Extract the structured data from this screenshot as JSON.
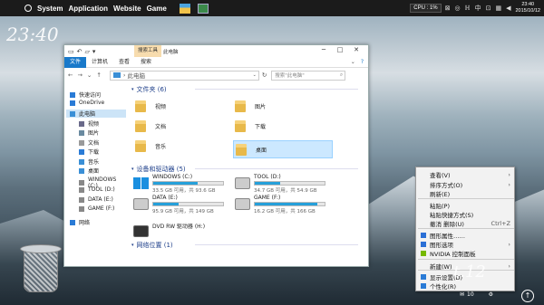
{
  "topbar": {
    "menus": [
      "System",
      "Application",
      "Website",
      "Game"
    ],
    "cpu_label": "CPU : 1%",
    "time": "23:40",
    "date": "2015/10/12",
    "symbols": [
      "⊠",
      "◎",
      "ℍ",
      "中",
      "⊡",
      "▦",
      "◀"
    ]
  },
  "desktop": {
    "big_clock": "23:40",
    "right_clock": "t.12"
  },
  "explorer": {
    "ribbon_context_tab": "搜索工具",
    "title": "此电脑",
    "tabs": [
      "文件",
      "计算机",
      "查看",
      "搜索"
    ],
    "address": "此电脑",
    "search_placeholder": "搜索\"此电脑\"",
    "nav": [
      {
        "label": "快速访问",
        "color": "#2a7bd6"
      },
      {
        "label": "OneDrive",
        "color": "#2a7bd6"
      },
      {
        "label": "此电脑",
        "color": "#3a8fd6"
      },
      {
        "label": "视频",
        "color": "#6a6a8a"
      },
      {
        "label": "图片",
        "color": "#6a8aa0"
      },
      {
        "label": "文档",
        "color": "#9a9a9a"
      },
      {
        "label": "下载",
        "color": "#2a7bd6"
      },
      {
        "label": "音乐",
        "color": "#3a8fd6"
      },
      {
        "label": "桌面",
        "color": "#3a8fd6"
      },
      {
        "label": "WINDOWS (C:)",
        "color": "#888"
      },
      {
        "label": "TOOL (D:)",
        "color": "#888"
      },
      {
        "label": "DATA (E:)",
        "color": "#888"
      },
      {
        "label": "GAME (F:)",
        "color": "#888"
      },
      {
        "label": "网络",
        "color": "#2a7bd6"
      }
    ],
    "folders_header": "文件夹 (6)",
    "folders": [
      "视频",
      "图片",
      "文档",
      "下载",
      "音乐",
      "桌面"
    ],
    "devices_header": "设备和驱动器 (5)",
    "drives": [
      {
        "name": "WINDOWS (C:)",
        "free": "33.5 GB 可用，共 93.6 GB",
        "used_fraction": 0.64,
        "type": "win"
      },
      {
        "name": "TOOL (D:)",
        "free": "34.7 GB 可用，共 54.9 GB",
        "used_fraction": 0.37,
        "type": "hdd"
      },
      {
        "name": "DATA (E:)",
        "free": "95.9 GB 可用，共 149 GB",
        "used_fraction": 0.36,
        "type": "hdd"
      },
      {
        "name": "GAME (F:)",
        "free": "16.2 GB 可用，共 166 GB",
        "used_fraction": 0.9,
        "type": "hdd"
      },
      {
        "name": "DVD RW 驱动器 (H:)",
        "type": "dvd"
      }
    ],
    "network_header": "网络位置 (1)"
  },
  "context_menu": {
    "items": [
      {
        "label": "查看(V)",
        "accel": "›"
      },
      {
        "label": "排序方式(O)",
        "accel": "›"
      },
      {
        "label": "刷新(E)",
        "accel": ""
      },
      {
        "label": "粘贴(P)",
        "accel": ""
      },
      {
        "label": "粘贴快捷方式(S)",
        "accel": ""
      },
      {
        "label": "撤消 删除(U)",
        "accel": "Ctrl+Z"
      },
      {
        "label": "图形属性……",
        "accel": ""
      },
      {
        "label": "图形选项",
        "accel": "›"
      },
      {
        "label": "NVIDIA 控制面板",
        "accel": ""
      },
      {
        "label": "新建(W)",
        "accel": "›"
      },
      {
        "label": "显示设置(D)",
        "accel": ""
      },
      {
        "label": "个性化(R)",
        "accel": ""
      }
    ]
  },
  "taskbar": {
    "notif_text": "10"
  }
}
